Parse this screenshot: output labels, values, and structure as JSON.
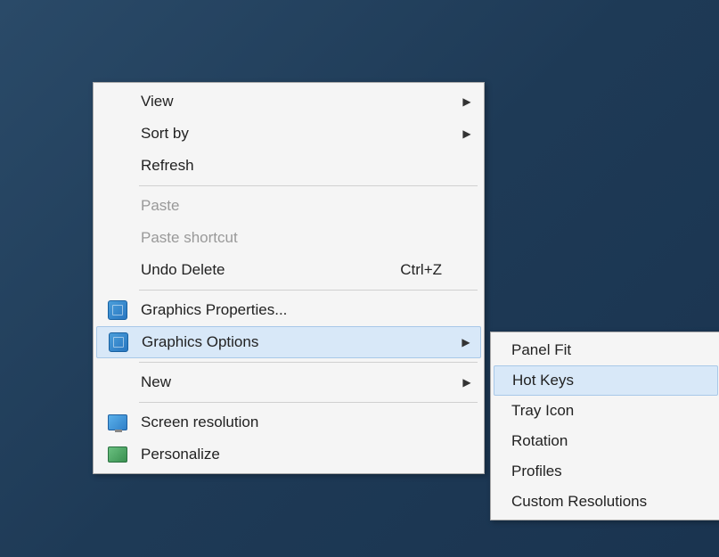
{
  "mainMenu": {
    "view": "View",
    "sortBy": "Sort by",
    "refresh": "Refresh",
    "paste": "Paste",
    "pasteShortcut": "Paste shortcut",
    "undoDelete": "Undo Delete",
    "undoDeleteShortcut": "Ctrl+Z",
    "graphicsProperties": "Graphics Properties...",
    "graphicsOptions": "Graphics Options",
    "new": "New",
    "screenResolution": "Screen resolution",
    "personalize": "Personalize"
  },
  "subMenu": {
    "panelFit": "Panel Fit",
    "hotKeys": "Hot Keys",
    "trayIcon": "Tray Icon",
    "rotation": "Rotation",
    "profiles": "Profiles",
    "customResolutions": "Custom Resolutions"
  }
}
